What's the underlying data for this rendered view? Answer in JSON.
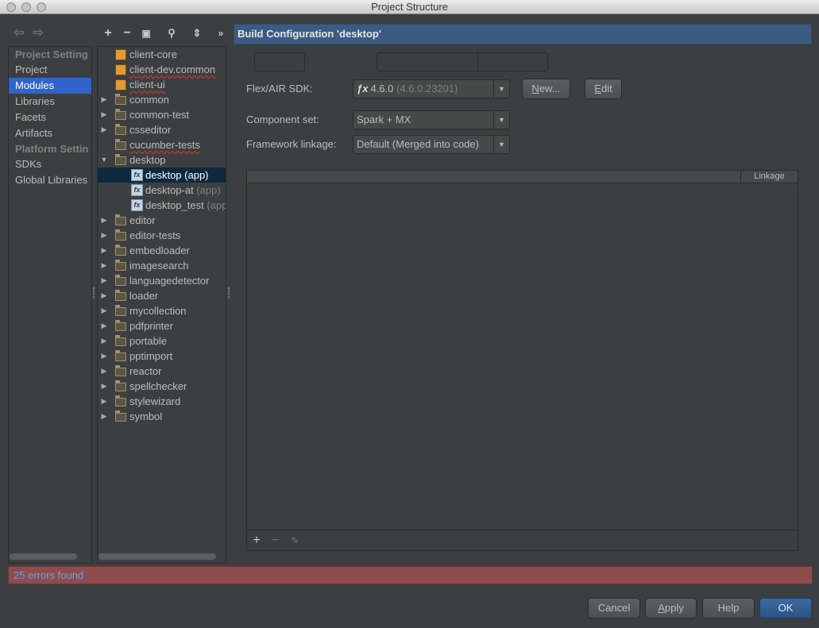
{
  "window": {
    "title": "Project Structure"
  },
  "nav": {
    "items": [
      {
        "label": "Project Setting",
        "type": "header"
      },
      {
        "label": "Project",
        "type": "item"
      },
      {
        "label": "Modules",
        "type": "item",
        "selected": true
      },
      {
        "label": "Libraries",
        "type": "item"
      },
      {
        "label": "Facets",
        "type": "item"
      },
      {
        "label": "Artifacts",
        "type": "item"
      },
      {
        "label": "Platform Settin",
        "type": "header"
      },
      {
        "label": "SDKs",
        "type": "item"
      },
      {
        "label": "Global Libraries",
        "type": "item"
      }
    ]
  },
  "toolbar": {
    "more": "»"
  },
  "tree": {
    "items": [
      {
        "label": "client-core",
        "icon": "module-icon",
        "squiggle": false
      },
      {
        "label": "client-dev.common",
        "icon": "module-icon",
        "squiggle": true
      },
      {
        "label": "client-ui",
        "icon": "module-icon",
        "squiggle": true
      },
      {
        "label": "common",
        "icon": "folder-icon",
        "arrow": "▶"
      },
      {
        "label": "common-test",
        "icon": "folder-icon",
        "arrow": "▶"
      },
      {
        "label": "csseditor",
        "icon": "folder-icon",
        "arrow": "▶"
      },
      {
        "label": "cucumber-tests",
        "icon": "folder-icon",
        "squiggle": true
      },
      {
        "label": "desktop",
        "icon": "folder-icon",
        "arrow": "▼"
      },
      {
        "label": "desktop",
        "suffix": " (app)",
        "icon": "flex-config-icon",
        "indent": 2,
        "selected": true
      },
      {
        "label": "desktop-at",
        "suffix": " (app)",
        "icon": "flex-config-icon",
        "indent": 2
      },
      {
        "label": "desktop_test",
        "suffix": " (app",
        "icon": "flex-config-icon",
        "indent": 2
      },
      {
        "label": "editor",
        "icon": "folder-icon",
        "arrow": "▶"
      },
      {
        "label": "editor-tests",
        "icon": "folder-icon",
        "arrow": "▶"
      },
      {
        "label": "embedloader",
        "icon": "folder-icon",
        "arrow": "▶"
      },
      {
        "label": "imagesearch",
        "icon": "folder-icon",
        "arrow": "▶"
      },
      {
        "label": "languagedetector",
        "icon": "folder-icon",
        "arrow": "▶"
      },
      {
        "label": "loader",
        "icon": "folder-icon",
        "arrow": "▶"
      },
      {
        "label": "mycollection",
        "icon": "folder-icon",
        "arrow": "▶"
      },
      {
        "label": "pdfprinter",
        "icon": "folder-icon",
        "arrow": "▶"
      },
      {
        "label": "portable",
        "icon": "folder-icon",
        "arrow": "▶"
      },
      {
        "label": "pptimport",
        "icon": "folder-icon",
        "arrow": "▶"
      },
      {
        "label": "reactor",
        "icon": "folder-icon",
        "arrow": "▶"
      },
      {
        "label": "spellchecker",
        "icon": "folder-icon",
        "arrow": "▶"
      },
      {
        "label": "stylewizard",
        "icon": "folder-icon",
        "arrow": "▶"
      },
      {
        "label": "symbol",
        "icon": "folder-icon",
        "arrow": "▶"
      }
    ]
  },
  "config": {
    "header": "Build Configuration 'desktop'",
    "sdk": {
      "label": "Flex/AIR SDK:",
      "value": "4.6.0",
      "detail": " (4.6.0.23201)"
    },
    "new_button": {
      "pre": "",
      "u": "N",
      "post": "ew..."
    },
    "edit_button": {
      "pre": "",
      "u": "E",
      "post": "dit"
    },
    "component_set": {
      "label": "Component set:",
      "value": "Spark + MX"
    },
    "framework_linkage": {
      "label": "Framework linkage:",
      "value": "Default (Merged into code)"
    },
    "table": {
      "linkage_header": "Linkage"
    }
  },
  "status": {
    "errors": "25 errors found"
  },
  "buttons": {
    "cancel": "Cancel",
    "apply": {
      "u": "A",
      "post": "pply"
    },
    "help": "Help",
    "ok": "OK"
  },
  "colors": {
    "selection": "#2f65ca",
    "error_bar": "#8d4d4d",
    "header": "#3a5b82"
  }
}
